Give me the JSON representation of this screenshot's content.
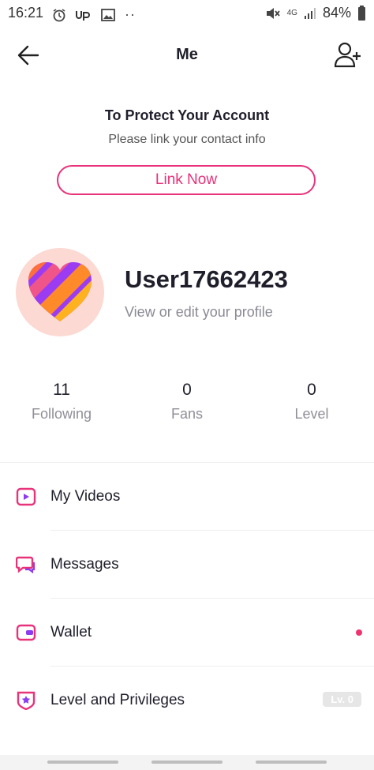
{
  "status_bar": {
    "time": "16:21",
    "network": "4G",
    "battery": "84%",
    "more": "··"
  },
  "header": {
    "title": "Me"
  },
  "protect": {
    "title": "To Protect Your Account",
    "subtitle": "Please link your contact info",
    "button_label": "Link Now"
  },
  "profile": {
    "username": "User17662423",
    "edit_hint": "View or edit your profile"
  },
  "stats": [
    {
      "value": "11",
      "label": "Following"
    },
    {
      "value": "0",
      "label": "Fans"
    },
    {
      "value": "0",
      "label": "Level"
    }
  ],
  "menu": [
    {
      "label": "My Videos",
      "icon": "video-icon"
    },
    {
      "label": "Messages",
      "icon": "messages-icon"
    },
    {
      "label": "Wallet",
      "icon": "wallet-icon"
    },
    {
      "label": "Level and Privileges",
      "icon": "level-shield-icon",
      "badge": "Lv. 0"
    }
  ],
  "colors": {
    "accent": "#e8327a",
    "notification_dot": "#f0326f",
    "avatar_bg": "#fcd9d2"
  }
}
